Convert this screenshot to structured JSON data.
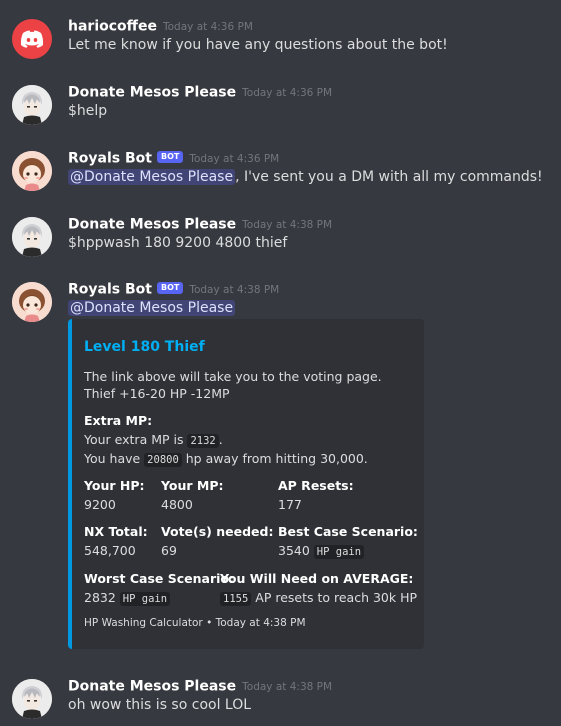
{
  "messages": [
    {
      "username": "hariocoffee",
      "timestamp": "Today at 4:36 PM",
      "content": "Let me know if you have any questions about the bot!"
    },
    {
      "username": "Donate Mesos Please",
      "timestamp": "Today at 4:36 PM",
      "content": "$help"
    },
    {
      "username": "Royals Bot",
      "badge": "BOT",
      "timestamp": "Today at 4:36 PM",
      "mention": "@Donate Mesos Please",
      "content": ", I've sent you a DM with all my commands!"
    },
    {
      "username": "Donate Mesos Please",
      "timestamp": "Today at 4:38 PM",
      "content": "$hppwash 180 9200 4800 thief"
    },
    {
      "username": "Royals Bot",
      "badge": "BOT",
      "timestamp": "Today at 4:38 PM",
      "mention": "@Donate Mesos Please"
    },
    {
      "username": "Donate Mesos Please",
      "timestamp": "Today at 4:38 PM",
      "content": "oh wow this is so cool LOL"
    }
  ],
  "embed": {
    "accent_color": "#0099e1",
    "title": "Level 180 Thief",
    "desc_line1": "The link above will take you to the voting page.",
    "desc_line2": "Thief +16-20 HP -12MP",
    "extra_mp_label": "Extra MP:",
    "extra_mp_pre": "Your extra MP is ",
    "extra_mp_value": "2132",
    "extra_mp_post": ".",
    "hp_away_pre": "You have ",
    "hp_away_value": "20800",
    "hp_away_post": " hp away from hitting 30,000.",
    "fields": {
      "your_hp": {
        "name": "Your HP:",
        "value": "9200"
      },
      "your_mp": {
        "name": "Your MP:",
        "value": "4800"
      },
      "ap_resets": {
        "name": "AP Resets:",
        "value": "177"
      },
      "nx_total": {
        "name": "NX Total:",
        "value": "548,700"
      },
      "votes_needed": {
        "name": "Vote(s) needed:",
        "value": "69"
      },
      "best_case": {
        "name": "Best Case Scenario:",
        "value": "3540",
        "code": "HP gain"
      },
      "worst_case": {
        "name": "Worst Case Scenario:",
        "value": "2832",
        "code": "HP gain"
      },
      "average": {
        "name": "You Will Need on AVERAGE:",
        "code": "1155",
        "value": " AP resets to reach 30k HP"
      }
    },
    "footer": "HP Washing Calculator • Today at 4:38 PM"
  },
  "colors": {
    "background": "#36393f",
    "discord_red": "#ed4245",
    "bot_badge": "#5865f2",
    "embed_bg": "#2f3136",
    "embed_title": "#00aff4"
  }
}
